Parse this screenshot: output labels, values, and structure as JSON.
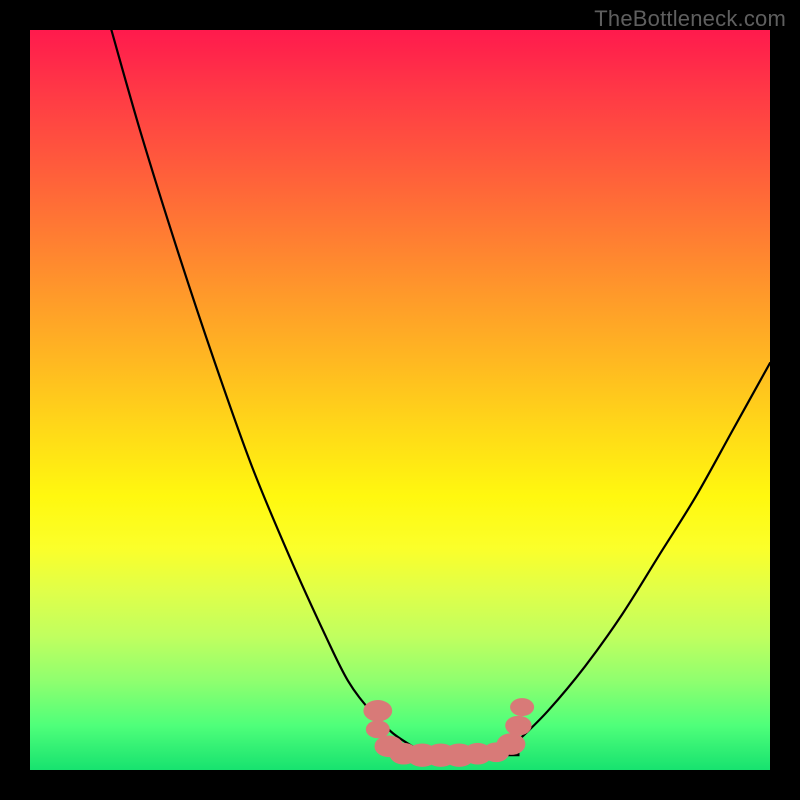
{
  "attribution": "TheBottleneck.com",
  "colors": {
    "frame": "#000000",
    "gradient_top": "#ff1a4d",
    "gradient_bottom": "#17e26f",
    "curve_stroke": "#000000",
    "marker_fill": "#d87a78",
    "marker_stroke": "#c46a66"
  },
  "chart_data": {
    "type": "line",
    "title": "",
    "xlabel": "",
    "ylabel": "",
    "xlim": [
      0,
      100
    ],
    "ylim": [
      0,
      100
    ],
    "series": [
      {
        "name": "left-curve",
        "x": [
          11,
          15,
          20,
          25,
          30,
          35,
          40,
          43,
          46,
          49,
          52
        ],
        "y": [
          100,
          86,
          70,
          55,
          41,
          29,
          18,
          12,
          8,
          5,
          3
        ]
      },
      {
        "name": "right-curve",
        "x": [
          66,
          70,
          75,
          80,
          85,
          90,
          95,
          100
        ],
        "y": [
          4,
          8,
          14,
          21,
          29,
          37,
          46,
          55
        ]
      }
    ],
    "flat_segment": {
      "x_start": 49,
      "x_end": 66,
      "y": 2
    },
    "markers": [
      {
        "x": 47,
        "y": 8,
        "r": 2.4
      },
      {
        "x": 47,
        "y": 5.5,
        "r": 2.0
      },
      {
        "x": 48.5,
        "y": 3.2,
        "r": 2.4
      },
      {
        "x": 50.5,
        "y": 2.2,
        "r": 2.4
      },
      {
        "x": 53,
        "y": 2.0,
        "r": 2.6
      },
      {
        "x": 55.5,
        "y": 2.0,
        "r": 2.6
      },
      {
        "x": 58,
        "y": 2.0,
        "r": 2.6
      },
      {
        "x": 60.5,
        "y": 2.2,
        "r": 2.4
      },
      {
        "x": 63,
        "y": 2.4,
        "r": 2.2
      },
      {
        "x": 65,
        "y": 3.5,
        "r": 2.4
      },
      {
        "x": 66,
        "y": 6.0,
        "r": 2.2
      },
      {
        "x": 66.5,
        "y": 8.5,
        "r": 2.0
      }
    ]
  }
}
